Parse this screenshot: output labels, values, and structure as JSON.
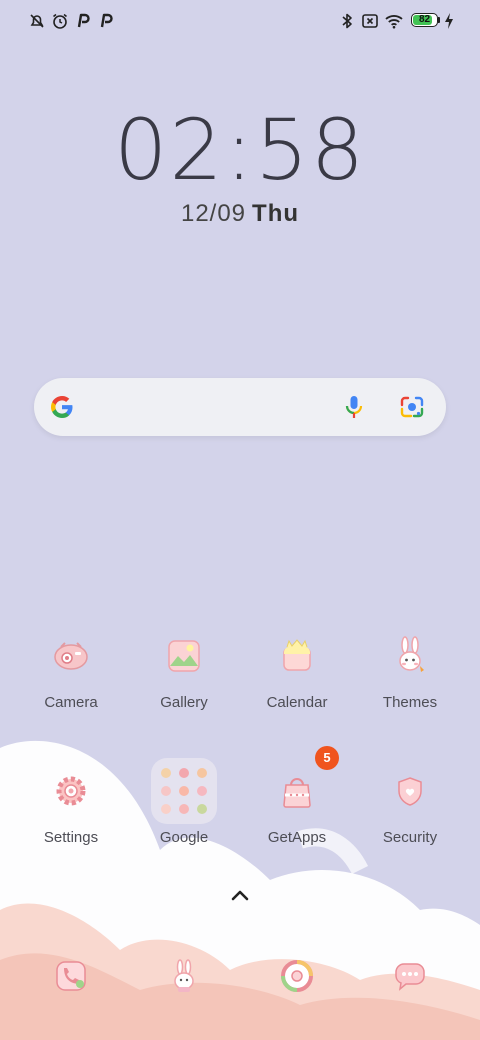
{
  "status_bar": {
    "left_icons": [
      "alarm-off-icon",
      "alarm-clock-icon",
      "p-notification-icon",
      "p-notification-icon"
    ],
    "right_icons": [
      "bluetooth-icon",
      "sim-none-icon",
      "wifi-icon",
      "battery-icon",
      "charging-bolt-icon"
    ],
    "battery_percent": "82",
    "battery_level": 0.82
  },
  "lock": {
    "time": "02:58",
    "date": "12/09",
    "weekday": "Thu"
  },
  "search_bar": {
    "icons": [
      "google-g-icon",
      "microphone-icon",
      "lens-camera-icon"
    ]
  },
  "apps_row1": [
    {
      "label": "Camera",
      "icon": "camera-icon"
    },
    {
      "label": "Gallery",
      "icon": "gallery-icon"
    },
    {
      "label": "Calendar",
      "icon": "calendar-icon"
    },
    {
      "label": "Themes",
      "icon": "themes-bunny-icon"
    }
  ],
  "apps_row2": [
    {
      "label": "Settings",
      "icon": "settings-gear-icon"
    },
    {
      "label": "Google",
      "icon": "google-folder-icon"
    },
    {
      "label": "GetApps",
      "icon": "shopping-bag-icon",
      "badge": "5"
    },
    {
      "label": "Security",
      "icon": "shield-heart-icon"
    }
  ],
  "dock": [
    "phone-icon",
    "bunny-contacts-icon",
    "browser-icon",
    "messages-icon"
  ],
  "colors": {
    "wallpaper": "#d3d3ea",
    "badge": "#f0541e",
    "battery_fill": "#41c254",
    "cloud": "#ffffff",
    "pink_cloud": "#f7cfc4"
  }
}
